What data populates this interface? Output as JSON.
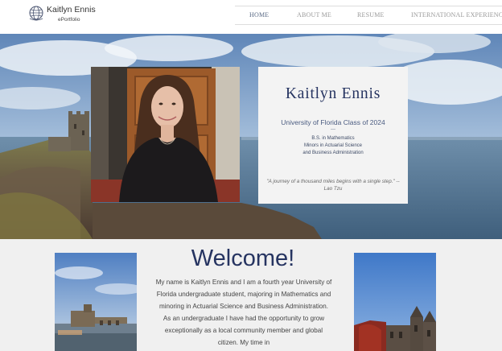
{
  "header": {
    "site_name": "Kaitlyn Ennis",
    "site_subtitle": "ePortfolio",
    "logo_icon": "globe-icon",
    "nav": [
      {
        "label": "HOME",
        "active": true
      },
      {
        "label": "ABOUT ME",
        "active": false
      },
      {
        "label": "RESUME",
        "active": false
      },
      {
        "label": "INTERNATIONAL EXPERIENCE",
        "active": false
      }
    ]
  },
  "hero": {
    "card": {
      "name": "Kaitlyn Ennis",
      "school": "University of Florida Class of 2024",
      "divider": "---",
      "degree_lines": [
        "B.S. in Mathematics",
        "Minors in Actuarial Science",
        "and Business Administration"
      ],
      "quote": "\"A journey of a thousand miles begins with a single step.\" -- Lao Tzu"
    }
  },
  "welcome": {
    "title": "Welcome!",
    "body": "My name is Kaitlyn Ennis and I am a fourth year University of Florida undergraduate student, majoring in Mathematics and minoring in Actuarial Science and Business Administration. As an undergraduate I have had the opportunity to grow exceptionally as a local community member and global citizen. My time in"
  },
  "colors": {
    "accent_navy": "#263461",
    "background": "#f0f0f0",
    "card_bg": "#f3f3f3"
  }
}
